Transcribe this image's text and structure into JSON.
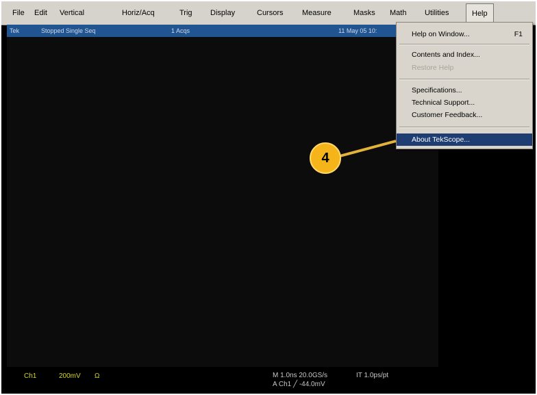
{
  "menubar": {
    "items": [
      "File",
      "Edit",
      "Vertical",
      "Horiz/Acq",
      "Trig",
      "Display",
      "Cursors",
      "Measure",
      "Masks",
      "Math",
      "Utilities",
      "Help"
    ]
  },
  "status": {
    "mode": "Tek",
    "state": "Stopped Single Seq",
    "acqs": "1 Acqs",
    "date": "11 May 05 10:"
  },
  "help_menu": {
    "items": [
      {
        "label": "Help on Window...",
        "shortcut": "F1"
      },
      {
        "label": "Contents and Index..."
      },
      {
        "label": "Restore Help"
      },
      {
        "label": "Specifications..."
      },
      {
        "label": "Technical Support..."
      },
      {
        "label": "Customer Feedback..."
      },
      {
        "label": "About TekScope..."
      }
    ]
  },
  "callout": {
    "number": "4"
  },
  "readouts": {
    "channel": "Ch1",
    "scale": "200mV",
    "coupling": "Ω",
    "timebase": "M 1.0ns 20.0GS/s",
    "record": "IT 1.0ps/pt",
    "trigger": "A  Ch1  ╱  -44.0mV"
  },
  "colors": {
    "menubar": "#d6d3cc",
    "statusbar": "#215592",
    "selection": "#1e3d72",
    "readout": "#d4d423",
    "callout": "#f4b41a"
  }
}
